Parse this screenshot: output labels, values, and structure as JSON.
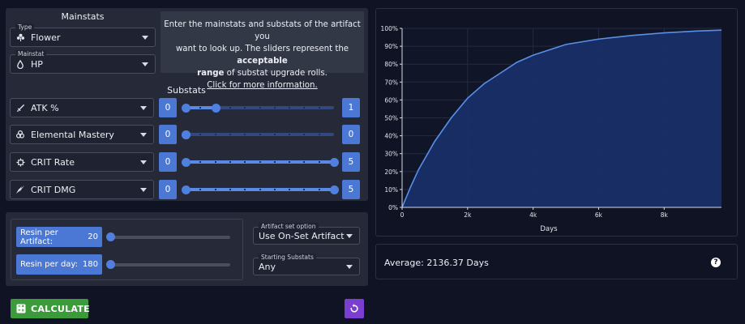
{
  "mainstats": {
    "title": "Mainstats",
    "type": {
      "legend": "Type",
      "value": "Flower",
      "icon": "flower-icon"
    },
    "mainstat": {
      "legend": "Mainstat",
      "value": "HP",
      "icon": "drop-icon"
    }
  },
  "info": {
    "line1": "Enter the mainstats and substats of the artifact you",
    "line2a": "want to look up. The sliders represent the ",
    "line2b": "acceptable",
    "line3a": "range",
    "line3b": " of substat upgrade rolls.",
    "link": "Click for more information."
  },
  "substats": {
    "title": "Substats",
    "items": [
      {
        "name": "ATK %",
        "icon": "sword-icon",
        "min": 0,
        "max": 1,
        "range_max": 5
      },
      {
        "name": "Elemental Mastery",
        "icon": "atom-icon",
        "min": 0,
        "max": 0,
        "range_max": 5
      },
      {
        "name": "CRIT Rate",
        "icon": "crosshair-icon",
        "min": 0,
        "max": 5,
        "range_max": 5
      },
      {
        "name": "CRIT DMG",
        "icon": "burst-icon",
        "min": 0,
        "max": 5,
        "range_max": 5
      }
    ]
  },
  "resin": {
    "per_artifact_label": "Resin per Artifact:",
    "per_artifact_value": "20",
    "per_day_label": "Resin per day:",
    "per_day_value": "180"
  },
  "options": {
    "set_option": {
      "legend": "Artifact set option",
      "value": "Use On-Set Artifact"
    },
    "starting_substats": {
      "legend": "Starting Substats",
      "value": "Any"
    }
  },
  "buttons": {
    "calculate": "CALCULATE"
  },
  "result": {
    "average": "Average: 2136.37 Days"
  },
  "chart_data": {
    "type": "area",
    "xlabel": "Days",
    "ylabel": "",
    "xlim": [
      0,
      9750
    ],
    "ylim": [
      0,
      100
    ],
    "x_ticks": [
      0,
      2000,
      4000,
      6000,
      8000
    ],
    "x_tick_labels": [
      "0",
      "2k",
      "4k",
      "6k",
      "8k"
    ],
    "y_ticks": [
      0,
      10,
      20,
      30,
      40,
      50,
      60,
      70,
      80,
      90,
      100
    ],
    "y_tick_labels": [
      "0%",
      "10%",
      "20%",
      "30%",
      "40%",
      "50%",
      "60%",
      "70%",
      "80%",
      "90%",
      "100%"
    ],
    "grid": true,
    "series": [
      {
        "x": [
          0,
          250,
          500,
          1000,
          1500,
          2000,
          2500,
          3000,
          3500,
          4000,
          5000,
          6000,
          7000,
          8000,
          9000,
          9750
        ],
        "y": [
          0,
          11,
          21,
          37,
          50,
          61,
          69,
          75,
          81,
          85,
          91,
          94,
          96,
          97.5,
          98.5,
          99
        ]
      }
    ],
    "line_color": "#5a8fe8",
    "fill_color": "#18306a"
  }
}
